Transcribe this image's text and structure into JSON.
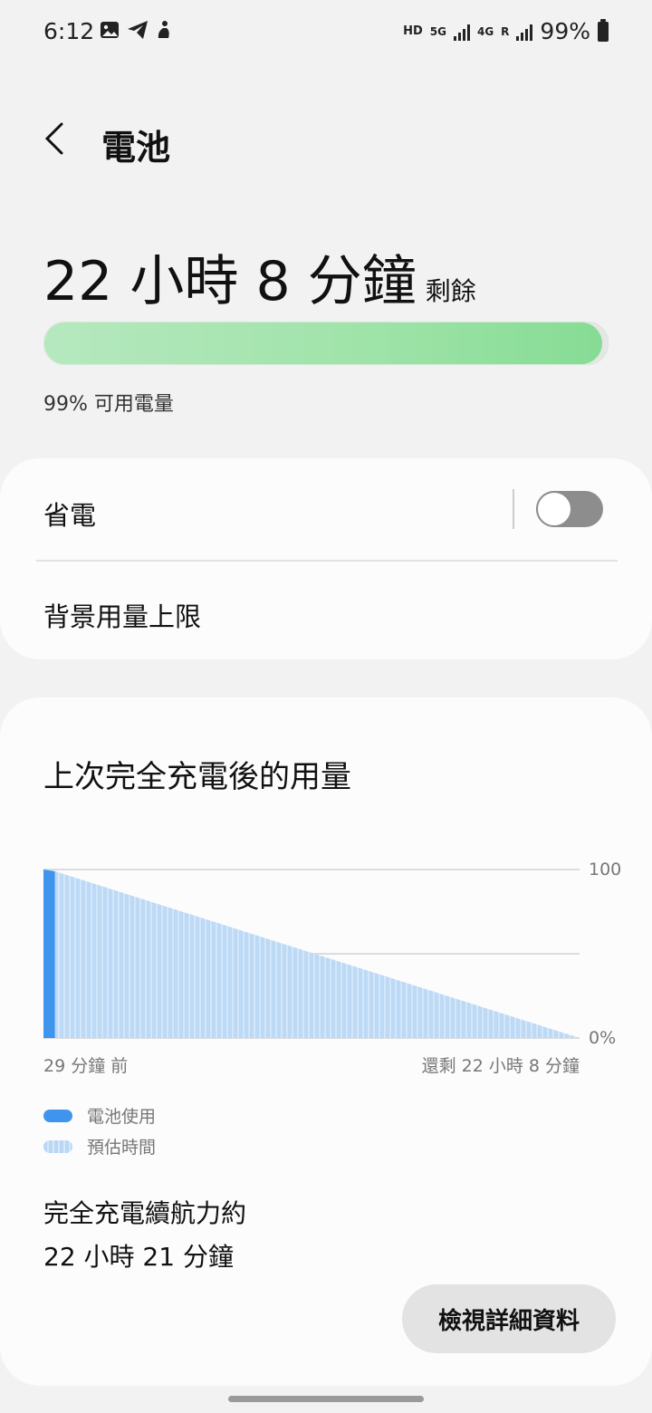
{
  "status_bar": {
    "time": "6:12",
    "left_icons": [
      "image-icon",
      "telegram-icon",
      "accessibility-icon"
    ],
    "hd": "HD",
    "net_5g": "5G",
    "net_4g": "4G",
    "roaming": "R",
    "battery_percent": "99%"
  },
  "header": {
    "title": "電池",
    "back_icon": "chevron-left-icon"
  },
  "battery": {
    "remaining_value": "22 小時 8 分鐘",
    "remaining_suffix": "剩餘",
    "level_fraction": 0.99,
    "available_text": "99% 可用電量",
    "fill_color": "#9ee3a8"
  },
  "settings": {
    "power_saving_label": "省電",
    "power_saving_on": false,
    "background_limit_label": "背景用量上限"
  },
  "usage": {
    "title": "上次完全充電後的用量",
    "legend": {
      "battery_use": "電池使用",
      "estimated_time": "預估時間"
    },
    "full_charge_label": "完全充電續航力約",
    "full_charge_value": "22 小時 21 分鐘",
    "details_button": "檢視詳細資料"
  },
  "chart_data": {
    "type": "area",
    "y_ticks": [
      "100",
      "0%"
    ],
    "ylim": [
      0,
      100
    ],
    "x_start_label": "29 分鐘 前",
    "x_end_label": "還剩 22 小時 8 分鐘",
    "series": [
      {
        "name": "電池使用",
        "x": [
          0,
          29
        ],
        "values": [
          100,
          99
        ],
        "color": "#3f95ee"
      },
      {
        "name": "預估時間",
        "x": [
          29,
          1357
        ],
        "values": [
          99,
          0
        ],
        "color": "#b9d7f5"
      }
    ],
    "x_range_minutes": [
      0,
      1357
    ],
    "grid": true
  },
  "colors": {
    "accent_blue": "#3f95ee",
    "estimate_blue": "#b9d7f5",
    "battery_green": "#9ee3a8"
  }
}
